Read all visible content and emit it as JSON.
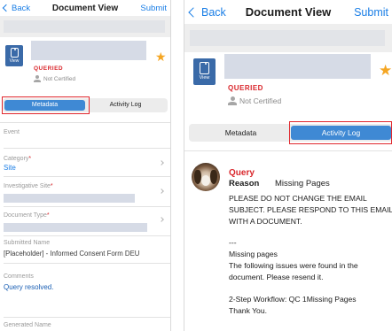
{
  "left": {
    "nav": {
      "back_label": "Back",
      "title": "Document View",
      "submit_label": "Submit"
    },
    "doc": {
      "view_label": "View",
      "status": "QUERIED",
      "certification": "Not Certified"
    },
    "tabs": [
      {
        "label": "Metadata",
        "active": true
      },
      {
        "label": "Activity Log",
        "active": false
      }
    ],
    "fields": {
      "event_label": "Event",
      "category_label": "Category",
      "category_value": "Site",
      "investigative_site_label": "Investigative Site",
      "document_type_label": "Document Type",
      "submitted_name_label": "Submitted Name",
      "submitted_name_value": "[Placeholder] - Informed Consent Form DEU",
      "comments_label": "Comments",
      "comments_value": "Query resolved.",
      "generated_name_label": "Generated Name"
    }
  },
  "right": {
    "nav": {
      "back_label": "Back",
      "title": "Document View",
      "submit_label": "Submit"
    },
    "doc": {
      "view_label": "View",
      "status": "QUERIED",
      "certification": "Not Certified"
    },
    "tabs": [
      {
        "label": "Metadata",
        "active": false
      },
      {
        "label": "Activity Log",
        "active": true
      }
    ],
    "query": {
      "title": "Query",
      "reason_label": "Reason",
      "reason_value": "Missing Pages",
      "lines": [
        "PLEASE DO NOT CHANGE THE EMAIL",
        "SUBJECT. PLEASE RESPOND TO THIS EMAIL",
        "WITH A DOCUMENT.",
        "---",
        "Missing pages",
        "The following issues were found in the",
        "document. Please resend it.",
        "2-Step Workflow: QC 1Missing Pages",
        "Thank You."
      ]
    }
  },
  "colors": {
    "accent_blue": "#1a7ee6",
    "active_tab": "#3f89d4",
    "queried_red": "#d9262b",
    "highlight_box": "#e0262c",
    "star": "#f5a623",
    "doc_icon": "#3a6aa8"
  },
  "icons": [
    "chevron-left-icon",
    "document-view-icon",
    "star-icon",
    "person-icon",
    "chevron-right-icon",
    "avatar-dog-image"
  ]
}
